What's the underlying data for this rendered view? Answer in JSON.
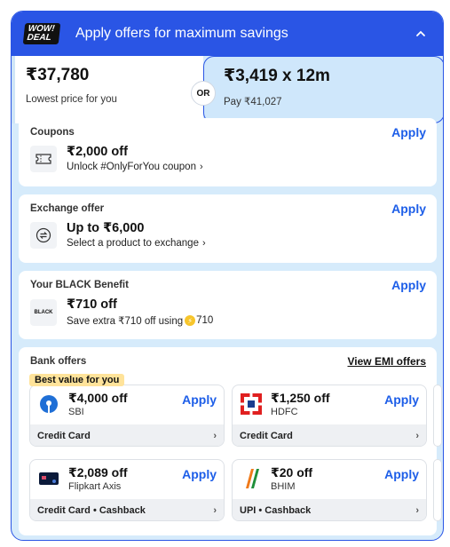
{
  "header": {
    "logo_line1": "WOW!",
    "logo_line2": "DEAL",
    "title": "Apply offers for maximum savings"
  },
  "pricing": {
    "lowest": {
      "price": "₹37,780",
      "label": "Lowest price for you"
    },
    "or_label": "OR",
    "emi": {
      "price": "₹3,419 x 12m",
      "label": "Pay ₹41,027"
    }
  },
  "coupons": {
    "title": "Coupons",
    "apply": "Apply",
    "amount": "₹2,000 off",
    "desc": "Unlock #OnlyForYou coupon"
  },
  "exchange": {
    "title": "Exchange offer",
    "apply": "Apply",
    "amount": "Up to ₹6,000",
    "desc": "Select a product to exchange"
  },
  "black": {
    "title": "Your BLACK Benefit",
    "apply": "Apply",
    "logo_text": "BLACK",
    "amount": "₹710 off",
    "desc_before": "Save extra ₹710 off using",
    "coins": "710"
  },
  "bank": {
    "title": "Bank offers",
    "emi_link": "View EMI offers",
    "best_badge": "Best value for you",
    "offers": [
      {
        "amount": "₹4,000 off",
        "bank": "SBI",
        "apply": "Apply",
        "type": "Credit Card"
      },
      {
        "amount": "₹1,250 off",
        "bank": "HDFC",
        "apply": "Apply",
        "type": "Credit Card"
      },
      {
        "amount": "₹2,089 off",
        "bank": "Flipkart Axis",
        "apply": "Apply",
        "type": "Credit Card • Cashback"
      },
      {
        "amount": "₹20 off",
        "bank": "BHIM",
        "apply": "Apply",
        "type": "UPI • Cashback"
      }
    ]
  },
  "colors": {
    "primary": "#2a55e5",
    "link": "#1d5ee8",
    "panel_bg": "#d6ebfb",
    "badge": "#ffe39a"
  }
}
